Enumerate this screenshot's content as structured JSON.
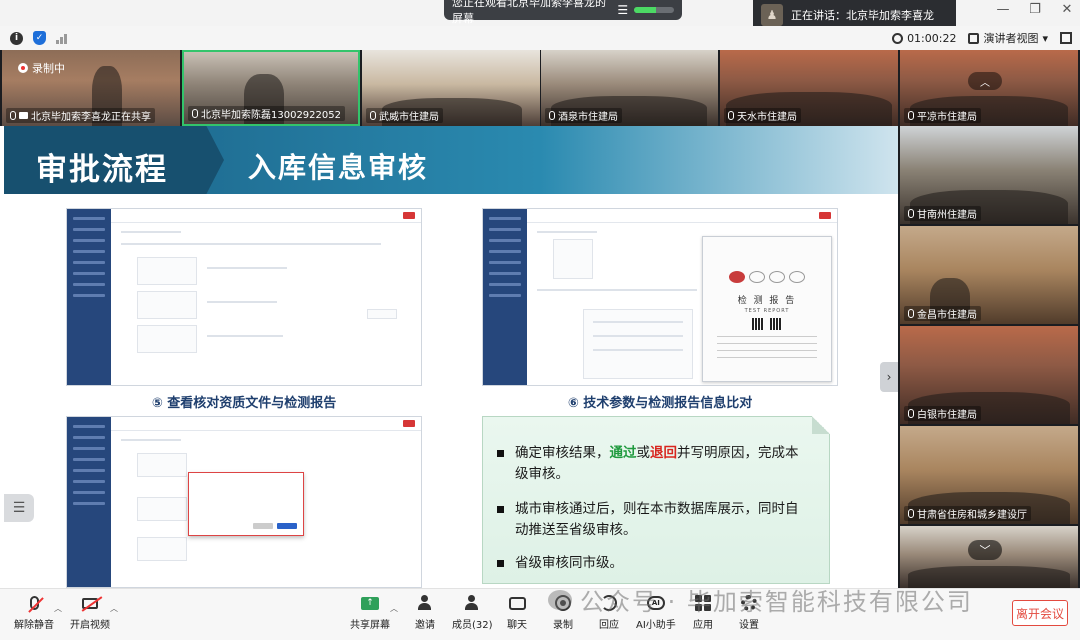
{
  "top_bar": {
    "share_notice": "您正在观看北京毕加索李喜龙的屏幕",
    "speaking_notice": "正在讲话：北京毕加索李喜龙"
  },
  "meeting_bar": {
    "timer": "01:00:22",
    "view_mode": "演讲者视图"
  },
  "top_tiles": [
    {
      "label": "北京毕加索李喜龙正在共享",
      "badge": "录制中"
    },
    {
      "label": "北京毕加索陈磊13002922052"
    },
    {
      "label": "武威市住建局"
    },
    {
      "label": "酒泉市住建局"
    },
    {
      "label": "天水市住建局"
    },
    {
      "label": "平凉市住建局"
    }
  ],
  "right_tiles": [
    {
      "label": "甘南州住建局"
    },
    {
      "label": "金昌市住建局"
    },
    {
      "label": "白银市住建局"
    },
    {
      "label": "甘肃省住房和城乡建设厅"
    }
  ],
  "slide": {
    "title_left": "审批流程",
    "title_right": "入库信息审核",
    "caption_5": "⑤ 查看核对资质文件与检测报告",
    "caption_6": "⑥ 技术参数与检测报告信息比对",
    "report_title": "检 测 报 告",
    "report_sub": "TEST REPORT",
    "notes": {
      "item1_prefix": "确定审核结果，",
      "item1_pass": "通过",
      "item1_or": "或",
      "item1_reject": "退回",
      "item1_suffix": "并写明原因，完成本级审核。",
      "item2": "城市审核通过后，则在本市数据库展示，同时自动推送至省级审核。",
      "item3": "省级审核同市级。"
    }
  },
  "bottom_toolbar": {
    "unmute": "解除静音",
    "video": "开启视频",
    "share": "共享屏幕",
    "invite": "邀请",
    "members": "成员(32)",
    "chat": "聊天",
    "record": "录制",
    "replay": "回应",
    "ai": "AI小助手",
    "apps": "应用",
    "settings": "设置",
    "leave": "离开会议"
  },
  "watermark": "公众号 · 毕加索智能科技有限公司",
  "colors": {
    "slide_header": "#1a5f84",
    "pass_green": "#1f9a3e",
    "reject_red": "#d8261f",
    "leave_red": "#e34a3f",
    "active_speaker": "#33c46b"
  }
}
